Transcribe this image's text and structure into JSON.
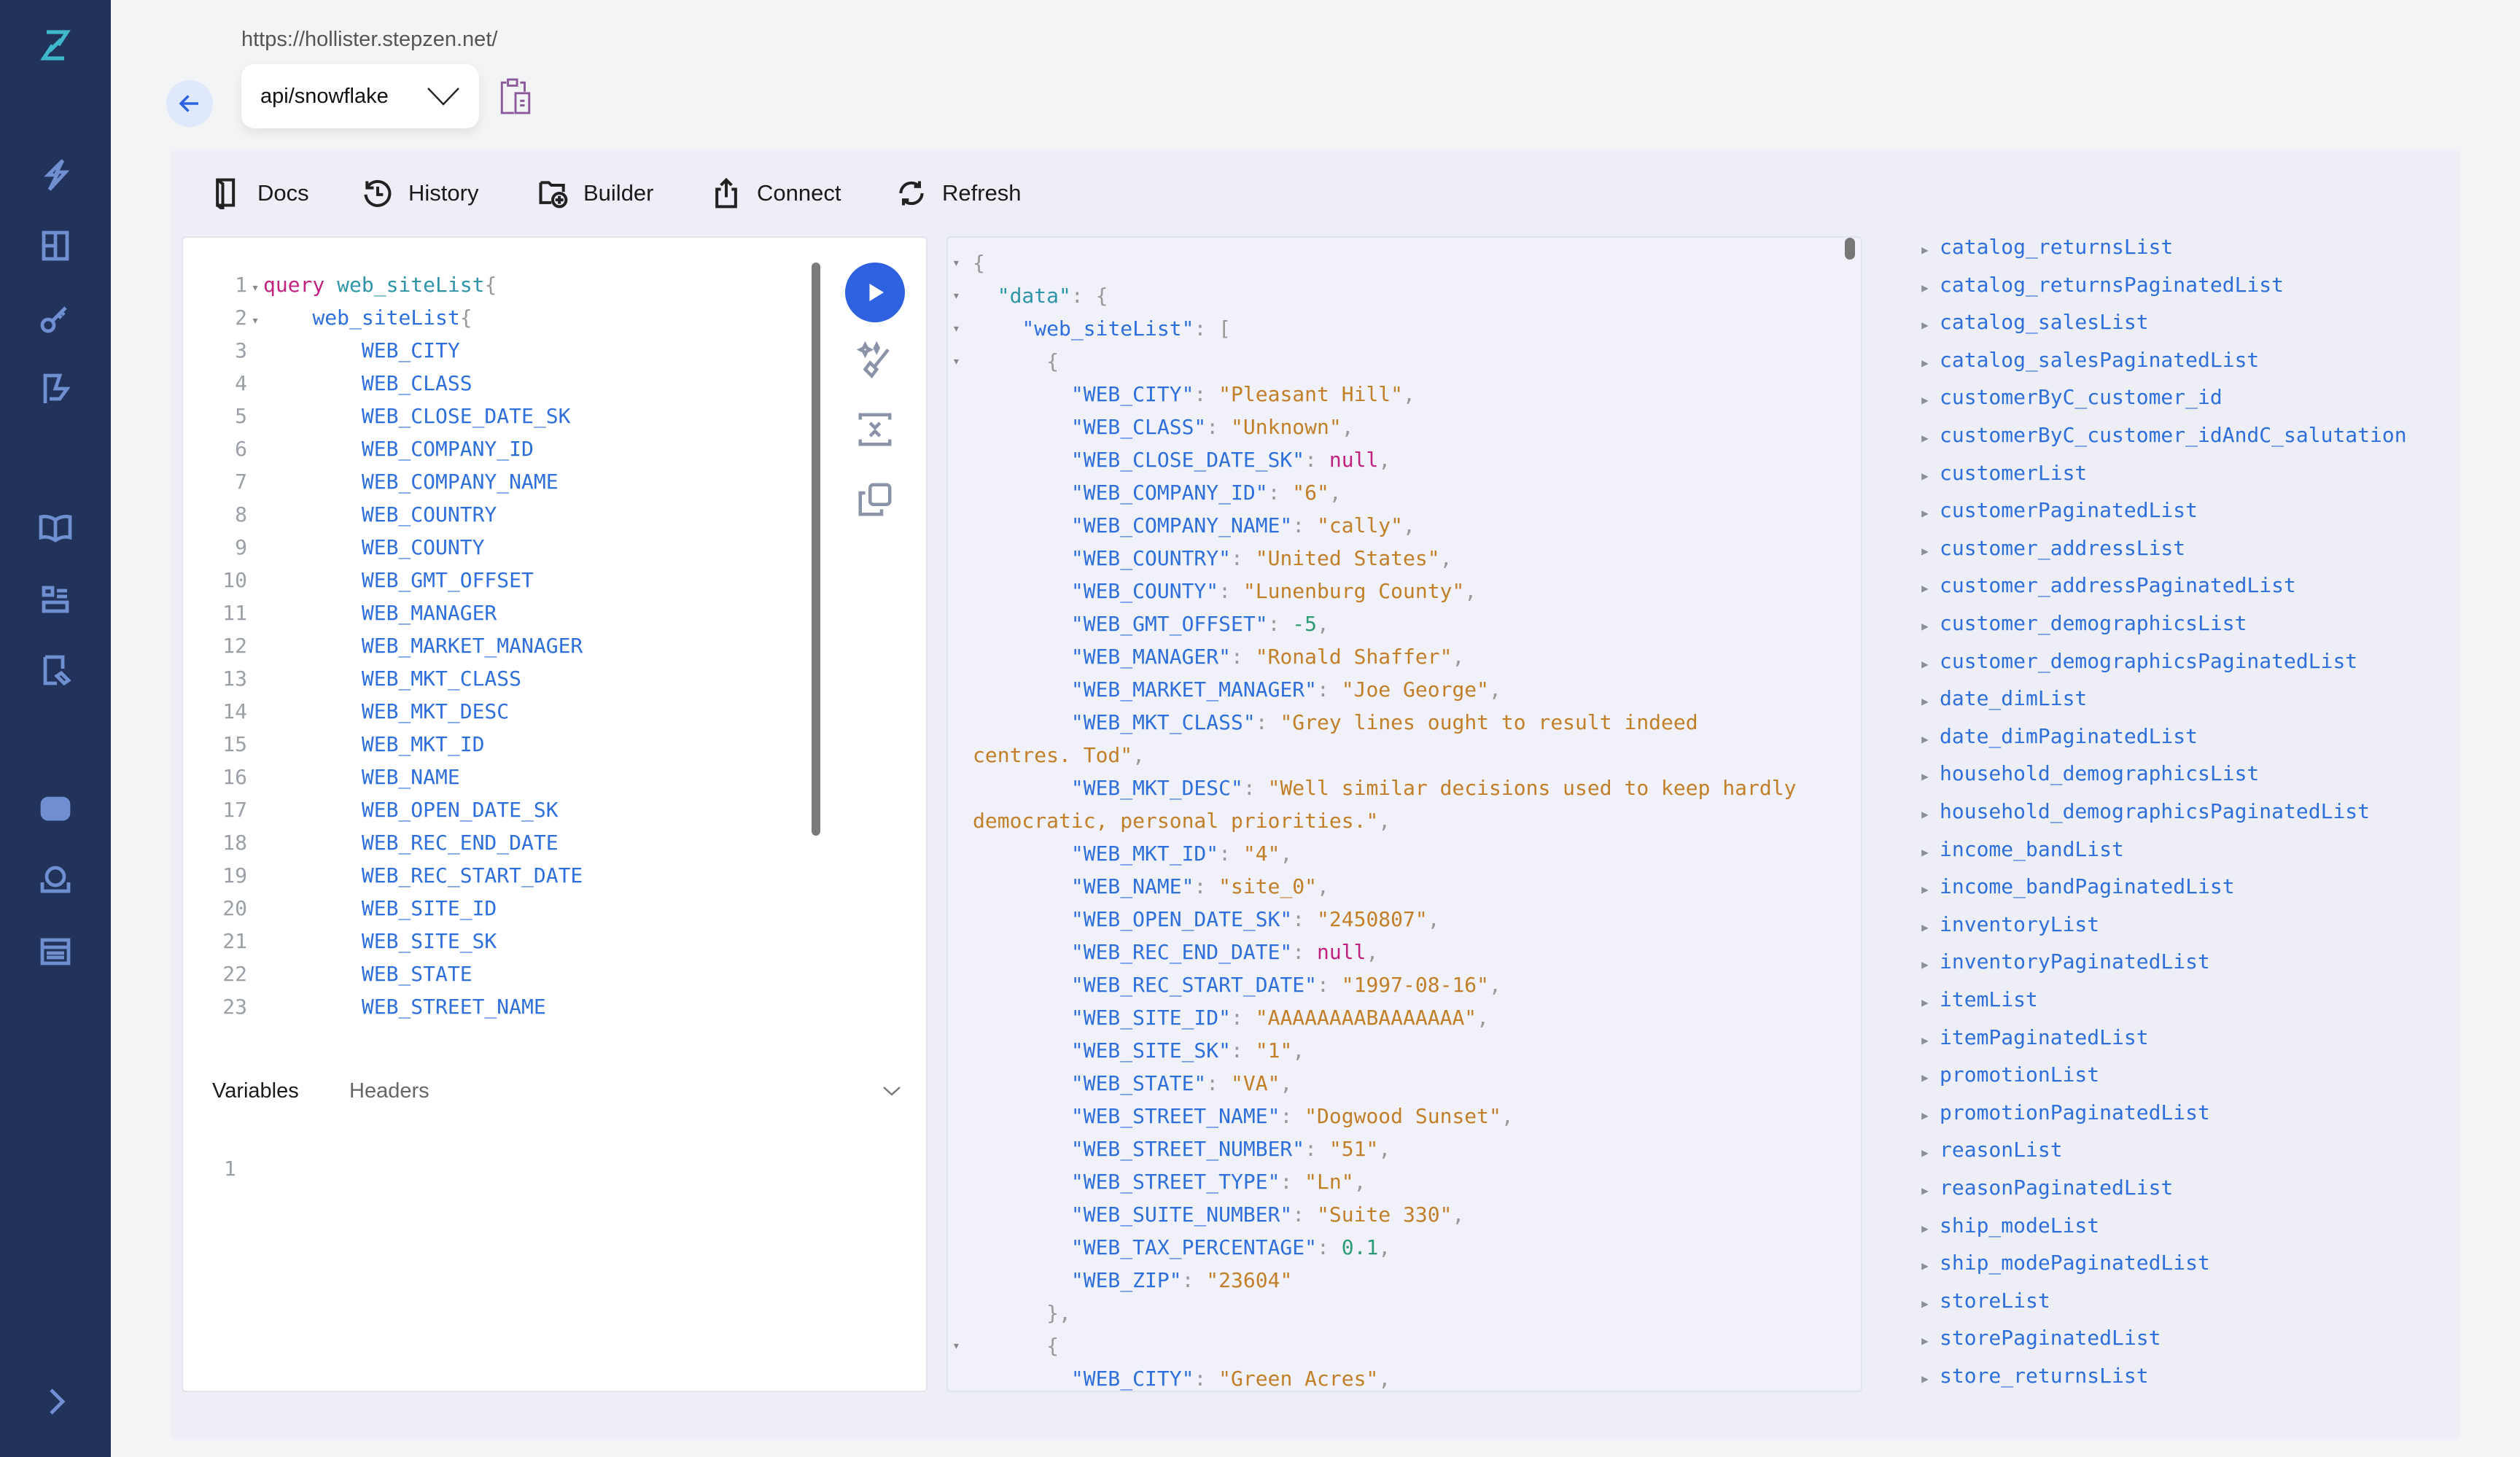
{
  "colors": {
    "sidebar": "#21325b",
    "accent": "#2f62e0",
    "key": "#2f6fdb",
    "string": "#c27f2a",
    "null": "#c2217f",
    "number": "#2d9b74"
  },
  "sidebar": {
    "icons": [
      "stepzen-logo-icon",
      "lightning-icon",
      "layout-icon",
      "key-icon",
      "flag-icon",
      "book-icon",
      "schema-icon",
      "docs-icon",
      "discord-icon",
      "support-icon",
      "billing-icon",
      "chevron-right-icon"
    ]
  },
  "header": {
    "url": "https://hollister.stepzen.net/",
    "endpoint": "api/snowflake"
  },
  "toolbar": {
    "docs": "Docs",
    "history": "History",
    "builder": "Builder",
    "connect": "Connect",
    "refresh": "Refresh"
  },
  "editor": {
    "keyword": "query",
    "operation": "web_siteList",
    "root_field": "web_siteList",
    "fields": [
      "WEB_CITY",
      "WEB_CLASS",
      "WEB_CLOSE_DATE_SK",
      "WEB_COMPANY_ID",
      "WEB_COMPANY_NAME",
      "WEB_COUNTRY",
      "WEB_COUNTY",
      "WEB_GMT_OFFSET",
      "WEB_MANAGER",
      "WEB_MARKET_MANAGER",
      "WEB_MKT_CLASS",
      "WEB_MKT_DESC",
      "WEB_MKT_ID",
      "WEB_NAME",
      "WEB_OPEN_DATE_SK",
      "WEB_REC_END_DATE",
      "WEB_REC_START_DATE",
      "WEB_SITE_ID",
      "WEB_SITE_SK",
      "WEB_STATE",
      "WEB_STREET_NAME"
    ],
    "variables_tab": "Variables",
    "headers_tab": "Headers",
    "variables_line": "1"
  },
  "result": {
    "data_key": "data",
    "list_key": "web_siteList",
    "record": [
      [
        "WEB_CITY",
        "\"Pleasant Hill\"",
        "str"
      ],
      [
        "WEB_CLASS",
        "\"Unknown\"",
        "str"
      ],
      [
        "WEB_CLOSE_DATE_SK",
        "null",
        "nul"
      ],
      [
        "WEB_COMPANY_ID",
        "\"6\"",
        "str"
      ],
      [
        "WEB_COMPANY_NAME",
        "\"cally\"",
        "str"
      ],
      [
        "WEB_COUNTRY",
        "\"United States\"",
        "str"
      ],
      [
        "WEB_COUNTY",
        "\"Lunenburg County\"",
        "str"
      ],
      [
        "WEB_GMT_OFFSET",
        "-5",
        "num"
      ],
      [
        "WEB_MANAGER",
        "\"Ronald Shaffer\"",
        "str"
      ],
      [
        "WEB_MARKET_MANAGER",
        "\"Joe George\"",
        "str"
      ],
      [
        "WEB_MKT_CLASS",
        "\"Grey lines ought to result indeed centres. Tod\"",
        "str"
      ],
      [
        "WEB_MKT_DESC",
        "\"Well similar decisions used to keep hardly democratic, personal priorities.\"",
        "str"
      ],
      [
        "WEB_MKT_ID",
        "\"4\"",
        "str"
      ],
      [
        "WEB_NAME",
        "\"site_0\"",
        "str"
      ],
      [
        "WEB_OPEN_DATE_SK",
        "\"2450807\"",
        "str"
      ],
      [
        "WEB_REC_END_DATE",
        "null",
        "nul"
      ],
      [
        "WEB_REC_START_DATE",
        "\"1997-08-16\"",
        "str"
      ],
      [
        "WEB_SITE_ID",
        "\"AAAAAAAABAAAAAAA\"",
        "str"
      ],
      [
        "WEB_SITE_SK",
        "\"1\"",
        "str"
      ],
      [
        "WEB_STATE",
        "\"VA\"",
        "str"
      ],
      [
        "WEB_STREET_NAME",
        "\"Dogwood Sunset\"",
        "str"
      ],
      [
        "WEB_STREET_NUMBER",
        "\"51\"",
        "str"
      ],
      [
        "WEB_STREET_TYPE",
        "\"Ln\"",
        "str"
      ],
      [
        "WEB_SUITE_NUMBER",
        "\"Suite 330\"",
        "str"
      ],
      [
        "WEB_TAX_PERCENTAGE",
        "0.1",
        "num"
      ],
      [
        "WEB_ZIP",
        "\"23604\"",
        "str"
      ]
    ],
    "next_record_first": [
      "WEB_CITY",
      "\"Green Acres\"",
      "str"
    ]
  },
  "schema": {
    "items": [
      "catalog_returnsList",
      "catalog_returnsPaginatedList",
      "catalog_salesList",
      "catalog_salesPaginatedList",
      "customerByC_customer_id",
      "customerByC_customer_idAndC_salutation",
      "customerList",
      "customerPaginatedList",
      "customer_addressList",
      "customer_addressPaginatedList",
      "customer_demographicsList",
      "customer_demographicsPaginatedList",
      "date_dimList",
      "date_dimPaginatedList",
      "household_demographicsList",
      "household_demographicsPaginatedList",
      "income_bandList",
      "income_bandPaginatedList",
      "inventoryList",
      "inventoryPaginatedList",
      "itemList",
      "itemPaginatedList",
      "promotionList",
      "promotionPaginatedList",
      "reasonList",
      "reasonPaginatedList",
      "ship_modeList",
      "ship_modePaginatedList",
      "storeList",
      "storePaginatedList",
      "store_returnsList"
    ]
  }
}
